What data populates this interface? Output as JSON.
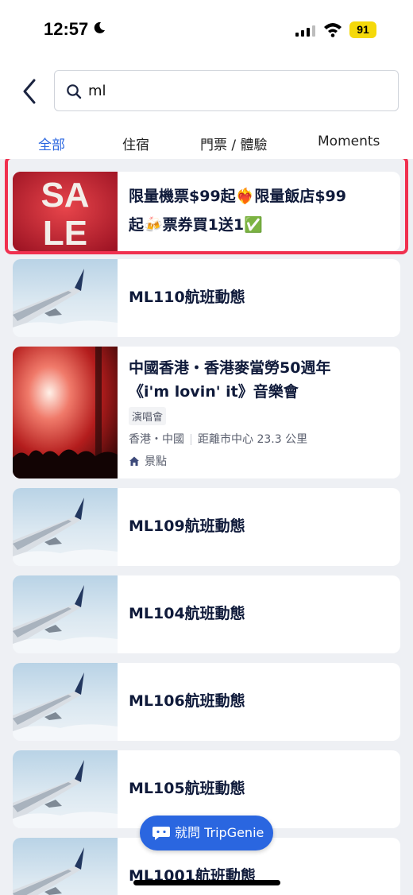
{
  "status_bar": {
    "time": "12:57",
    "battery": "91"
  },
  "search": {
    "value": "ml"
  },
  "tabs": [
    "全部",
    "住宿",
    "門票 / 體驗",
    "Moments"
  ],
  "promo": {
    "thumb_line1": "SA",
    "thumb_line2": "LE",
    "title_line1": "限量機票$99起❤️‍🔥限量飯店$99",
    "title_line2": "起🍻票券買1送1✅"
  },
  "results": [
    {
      "title": "ML110航班動態"
    },
    {
      "title_line1": "中國香港・香港麥當勞50週年",
      "title_line2": "《i'm lovin' it》音樂會",
      "tag": "演唱會",
      "location": "香港・中國",
      "distance": "距離市中心 23.3 公里",
      "category": "景點"
    },
    {
      "title": "ML109航班動態"
    },
    {
      "title": "ML104航班動態"
    },
    {
      "title": "ML106航班動態"
    },
    {
      "title": "ML105航班動態"
    },
    {
      "title": "ML1001航班動態"
    }
  ],
  "fab": {
    "label": "就問 TripGenie"
  },
  "colors": {
    "accent": "#2a66e0",
    "highlight": "#f0304f",
    "title": "#0f1a3a"
  }
}
